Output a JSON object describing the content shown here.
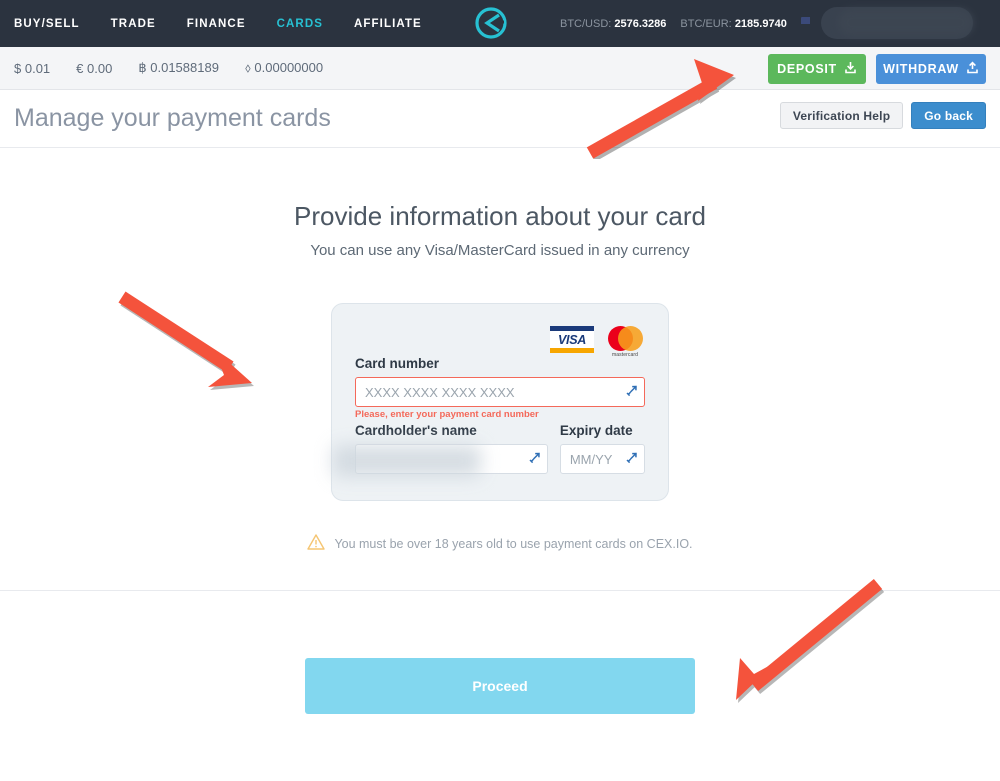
{
  "header": {
    "nav": [
      {
        "label": "BUY/SELL",
        "active": false
      },
      {
        "label": "TRADE",
        "active": false
      },
      {
        "label": "FINANCE",
        "active": false
      },
      {
        "label": "CARDS",
        "active": true
      },
      {
        "label": "AFFILIATE",
        "active": false
      }
    ],
    "logo_alt": "cex-io-logo",
    "tickers": [
      {
        "label": "BTC/USD:",
        "value": "2576.3286"
      },
      {
        "label": "BTC/EUR:",
        "value": "2185.9740"
      }
    ],
    "language_flag": "us-flag",
    "globe_icon": "globe-icon",
    "search_value": "",
    "search_placeholder": ""
  },
  "balance_bar": {
    "balances": [
      {
        "symbol": "$",
        "amount": "0.01"
      },
      {
        "symbol": "€",
        "amount": "0.00"
      },
      {
        "symbol": "฿",
        "amount": "0.01588189"
      },
      {
        "symbol": "⬨",
        "amount": "0.00000000"
      }
    ],
    "deposit_label": "DEPOSIT",
    "withdraw_label": "WITHDRAW"
  },
  "title_bar": {
    "title": "Manage your payment cards",
    "verification_help_label": "Verification Help",
    "go_back_label": "Go back"
  },
  "main": {
    "heading": "Provide information about your card",
    "subheading": "You can use any Visa/MasterCard issued in any currency",
    "brands": {
      "visa": "VISA",
      "mastercard": "mastercard"
    },
    "card_number": {
      "label": "Card number",
      "placeholder": "XXXX XXXX XXXX XXXX",
      "value": "",
      "error": "Please, enter your payment card number"
    },
    "cardholder_name": {
      "label": "Cardholder's name",
      "placeholder": "",
      "value": ""
    },
    "expiry_date": {
      "label": "Expiry date",
      "placeholder": "MM/YY",
      "value": ""
    },
    "age_warning": "You must be over 18 years old to use payment cards on CEX.IO.",
    "proceed_label": "Proceed"
  },
  "colors": {
    "nav_bg": "#2b333f",
    "accent_cyan": "#27c1d3",
    "deposit_green": "#5cb85c",
    "withdraw_blue": "#4a90d9",
    "go_back_blue": "#3c8dcd",
    "error_red": "#f4695a",
    "proceed_blue": "#82d7ef",
    "annotation_red": "#f4533c"
  },
  "annotations": [
    {
      "name": "arrow-to-deposit",
      "direction": "up-right"
    },
    {
      "name": "arrow-to-card-form",
      "direction": "down-right"
    },
    {
      "name": "arrow-to-proceed",
      "direction": "down-left"
    }
  ]
}
